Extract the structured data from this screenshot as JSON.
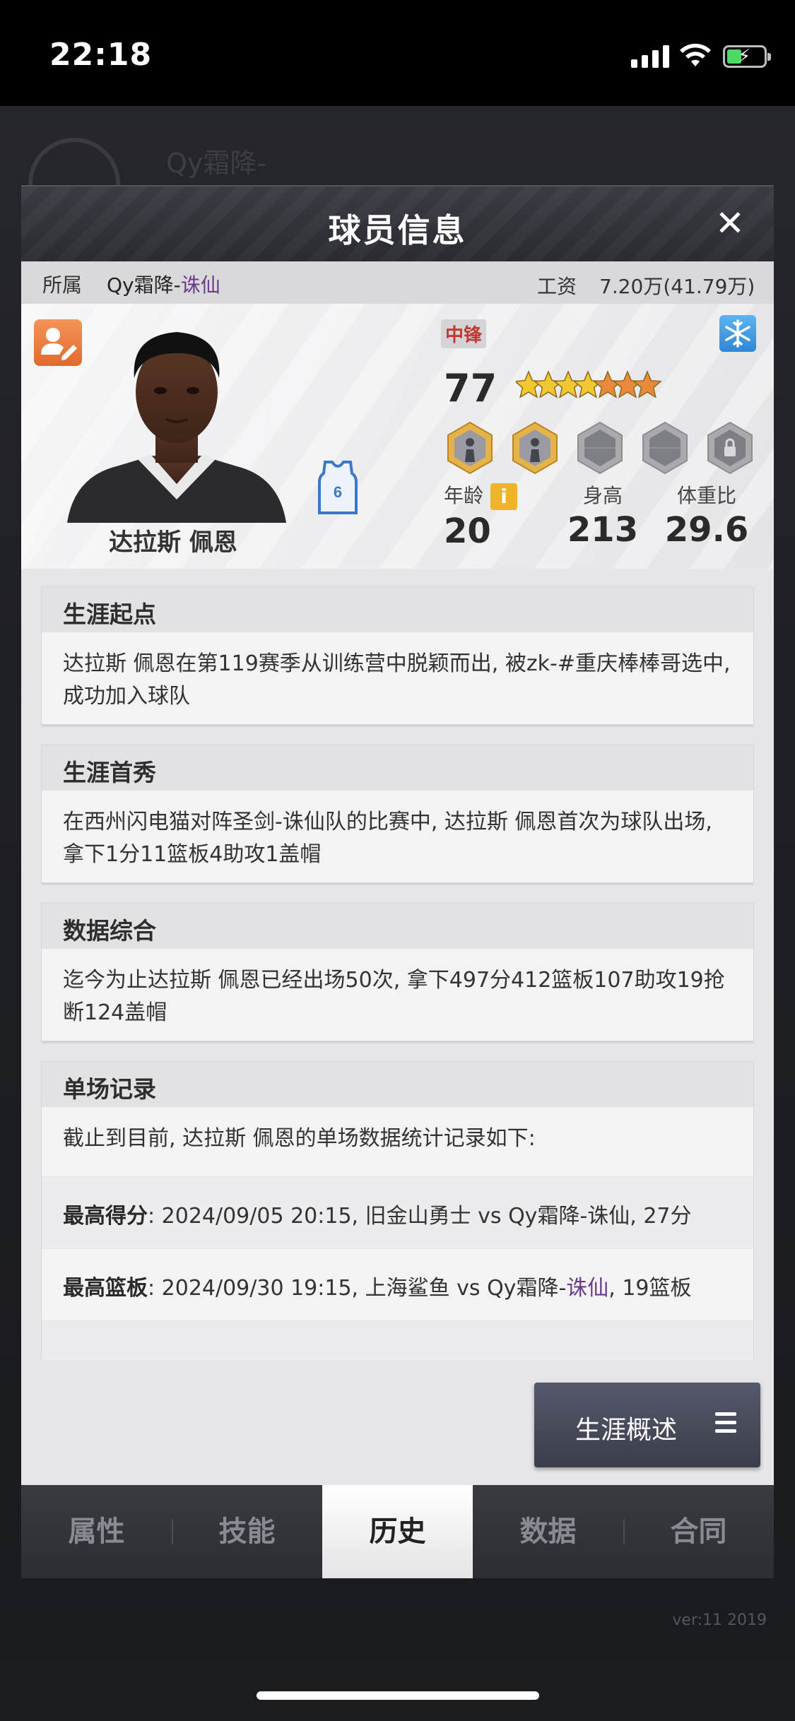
{
  "status_bar": {
    "time": "22:18"
  },
  "background": {
    "ghost_title": "Qy霜降-",
    "version": "ver:11  2019"
  },
  "modal": {
    "title": "球员信息",
    "close_symbol": "✕",
    "affiliation_label": "所属",
    "team_prefix": "Qy霜降-",
    "team_highlight": "诛仙",
    "salary_label": "工资",
    "salary_value": "7.20万(41.79万)"
  },
  "player": {
    "name": "达拉斯 佩恩",
    "jersey_number": "6",
    "position": "中锋",
    "rating": "77",
    "stars": {
      "gold": 4,
      "orange": 3
    },
    "age_label": "年龄",
    "age": "20",
    "height_label": "身高",
    "height": "213",
    "weight_label": "体重比",
    "weight": "29.6",
    "info_symbol": "i",
    "skills": [
      "skill-badge-1",
      "skill-badge-2",
      "empty-skill-slot",
      "empty-skill-slot",
      "locked-skill-slot"
    ]
  },
  "sections": {
    "career_start": {
      "title": "生涯起点",
      "body": "达拉斯 佩恩在第119赛季从训练营中脱颖而出, 被zk-#重庆棒棒哥选中, 成功加入球队"
    },
    "debut": {
      "title": "生涯首秀",
      "body": "在西州闪电猫对阵圣剑-诛仙队的比赛中, 达拉斯 佩恩首次为球队出场, 拿下1分11篮板4助攻1盖帽"
    },
    "summary": {
      "title": "数据综合",
      "body": "迄今为止达拉斯 佩恩已经出场50次, 拿下497分412篮板107助攻19抢断124盖帽"
    },
    "records": {
      "title": "单场记录",
      "intro": "截止到目前, 达拉斯 佩恩的单场数据统计记录如下:",
      "items": [
        {
          "label": "最高得分",
          "text": ": 2024/09/05 20:15, 旧金山勇士 vs Qy霜降-诛仙, 27分",
          "text_pre": "",
          "hl": "",
          "text_post": ""
        },
        {
          "label": "最高篮板",
          "text_pre": ": 2024/09/30 19:15, 上海鲨鱼 vs Qy霜降-",
          "hl": "诛仙",
          "text_post": ", 19篮板"
        }
      ]
    }
  },
  "career_button": {
    "label": "生涯概述"
  },
  "tabs": [
    {
      "label": "属性",
      "active": false
    },
    {
      "label": "技能",
      "active": false
    },
    {
      "label": "历史",
      "active": true
    },
    {
      "label": "数据",
      "active": false
    },
    {
      "label": "合同",
      "active": false
    }
  ],
  "colors": {
    "accent_purple": "#6b3a8a",
    "position_red": "#c43a2e",
    "star_gold": "#f2c832",
    "star_orange": "#e88a3a"
  }
}
